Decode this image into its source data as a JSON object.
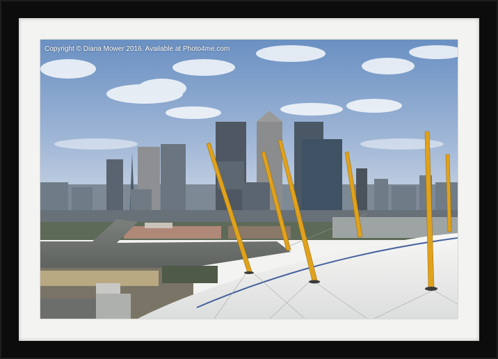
{
  "watermark": {
    "text": "Copyright  © Diana Mower  2016. Available at Photo4me.com"
  },
  "colors": {
    "frame": "#0c0c0c",
    "mount": "#f3f3f1",
    "sky_top": "#6e93c4",
    "sky_bottom": "#c9d6e6",
    "river": "#6b6f6c",
    "dome": "#f1f1ef",
    "mast": "#e0a21c"
  }
}
